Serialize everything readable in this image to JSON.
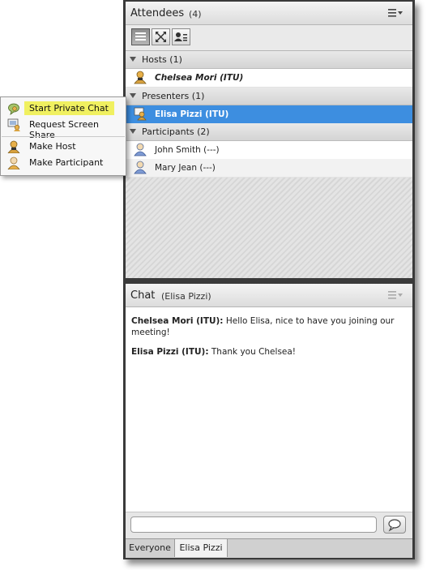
{
  "attendees": {
    "title": "Attendees",
    "count": "(4)",
    "groups": {
      "hosts": {
        "label": "Hosts (1)",
        "members": [
          {
            "name": "Chelsea Mori (ITU)"
          }
        ]
      },
      "presenters": {
        "label": "Presenters (1)",
        "members": [
          {
            "name": "Elisa Pizzi (ITU)"
          }
        ]
      },
      "participants": {
        "label": "Participants (2)",
        "members": [
          {
            "name": "John Smith (---)"
          },
          {
            "name": "Mary Jean (---)"
          }
        ]
      }
    }
  },
  "context_menu": {
    "items": [
      {
        "label": "Start Private Chat",
        "icon": "chat-bubble-icon"
      },
      {
        "label": "Request Screen Share",
        "icon": "screen-share-icon"
      },
      {
        "label": "Make Host",
        "icon": "host-user-icon"
      },
      {
        "label": "Make Participant",
        "icon": "participant-user-icon"
      }
    ]
  },
  "chat": {
    "title": "Chat",
    "subtitle": "(Elisa Pizzi)",
    "messages": [
      {
        "sender": "Chelsea Mori (ITU):",
        "text": " Hello Elisa, nice to have you joining our meeting!"
      },
      {
        "sender": "Elisa Pizzi (ITU):",
        "text": " Thank you Chelsea!"
      }
    ],
    "input": {
      "value": "",
      "placeholder": ""
    },
    "tabs": [
      "Everyone",
      "Elisa Pizzi"
    ]
  },
  "colors": {
    "selected_row": "#3d8ee0",
    "menu_highlight": "#f0f060",
    "frame": "#3a3a3a"
  }
}
